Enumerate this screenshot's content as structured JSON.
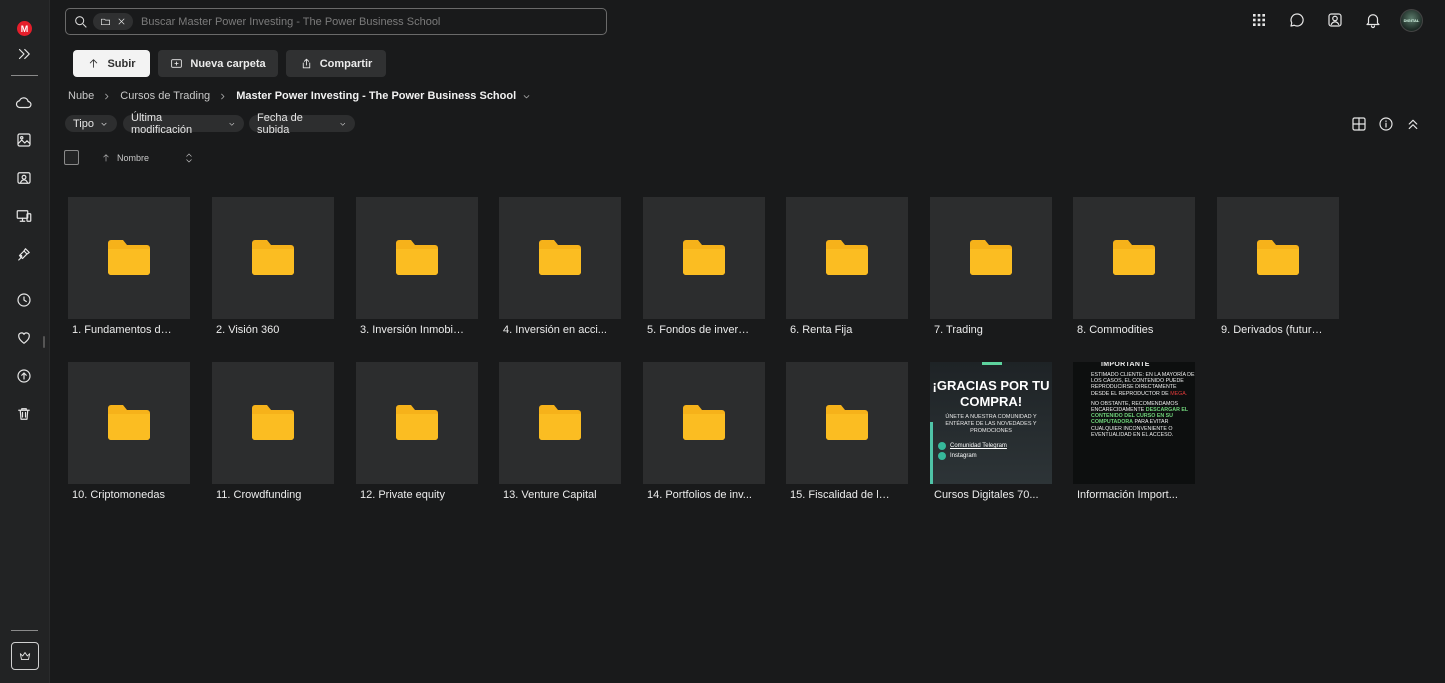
{
  "app": {
    "logo": "M"
  },
  "sidebar": {
    "items": [
      {
        "name": "expand-icon"
      },
      {
        "name": "cloud-icon"
      },
      {
        "name": "photos-icon"
      },
      {
        "name": "shared-items-icon"
      },
      {
        "name": "devices-icon"
      },
      {
        "name": "links-icon"
      },
      {
        "name": "recents-icon"
      },
      {
        "name": "favourites-icon"
      },
      {
        "name": "backups-icon"
      },
      {
        "name": "trash-icon"
      }
    ],
    "bottom_icon": "crown-icon"
  },
  "search": {
    "placeholder": "Buscar Master Power Investing - The Power Business School",
    "value": ""
  },
  "header_icons": [
    "apps-grid-icon",
    "chat-icon",
    "contacts-icon",
    "notifications-icon"
  ],
  "avatar": {
    "label": "DIGITAL"
  },
  "toolbar": {
    "upload_label": "Subir",
    "new_folder_label": "Nueva carpeta",
    "share_label": "Compartir"
  },
  "breadcrumb": {
    "items": [
      "Nube",
      "Cursos de Trading"
    ],
    "current": "Master Power Investing - The Power Business School"
  },
  "filters": {
    "type": "Tipo",
    "modified": "Última modificación",
    "uploaded": "Fecha de subida"
  },
  "sort": {
    "label": "Nombre"
  },
  "view_icons": [
    "grid-view-icon",
    "info-icon",
    "collapse-icon"
  ],
  "items": [
    {
      "name": "1. Fundamentos de l...",
      "kind": "folder"
    },
    {
      "name": "2. Visión 360",
      "kind": "folder"
    },
    {
      "name": "3. Inversión Inmobili...",
      "kind": "folder"
    },
    {
      "name": "4. Inversión en acci...",
      "kind": "folder"
    },
    {
      "name": "5. Fondos de inversi...",
      "kind": "folder"
    },
    {
      "name": "6. Renta Fija",
      "kind": "folder"
    },
    {
      "name": "7. Trading",
      "kind": "folder"
    },
    {
      "name": "8. Commodities",
      "kind": "folder"
    },
    {
      "name": "9. Derivados (futuro...",
      "kind": "folder"
    },
    {
      "name": "10. Criptomonedas",
      "kind": "folder"
    },
    {
      "name": "11. Crowdfunding",
      "kind": "folder"
    },
    {
      "name": "12. Private equity",
      "kind": "folder"
    },
    {
      "name": "13. Venture Capital",
      "kind": "folder"
    },
    {
      "name": "14. Portfolios de inv...",
      "kind": "folder"
    },
    {
      "name": "15. Fiscalidad de la i...",
      "kind": "folder"
    },
    {
      "name": "Cursos Digitales 70...",
      "kind": "image-thanks"
    },
    {
      "name": "Información Import...",
      "kind": "image-info"
    }
  ],
  "thumb_thanks": {
    "headline": "¡GRACIAS POR TU COMPRA!",
    "body": "ÚNETE A NUESTRA COMUNIDAD Y ENTÉRATE DE LAS NOVEDADES Y PROMOCIONES",
    "link1": "Comunidad Telegram",
    "link2": "Instagram"
  },
  "thumb_info": {
    "heading": "IMPORTANTE",
    "p1": "Estimado cliente: en la mayoría de los casos, el contenido puede reproducirse directamente desde el reproductor de",
    "p1_red": "MEGA.",
    "p2": "No obstante, recomendamos encarecidamente",
    "p2_green": "descargar el contenido del curso en su computadora",
    "p3": "para evitar cualquier inconveniente o eventualidad en el acceso."
  },
  "colors": {
    "background": "#191a1b",
    "folder": "#f6b21a",
    "accent_red": "#e51e2b"
  }
}
